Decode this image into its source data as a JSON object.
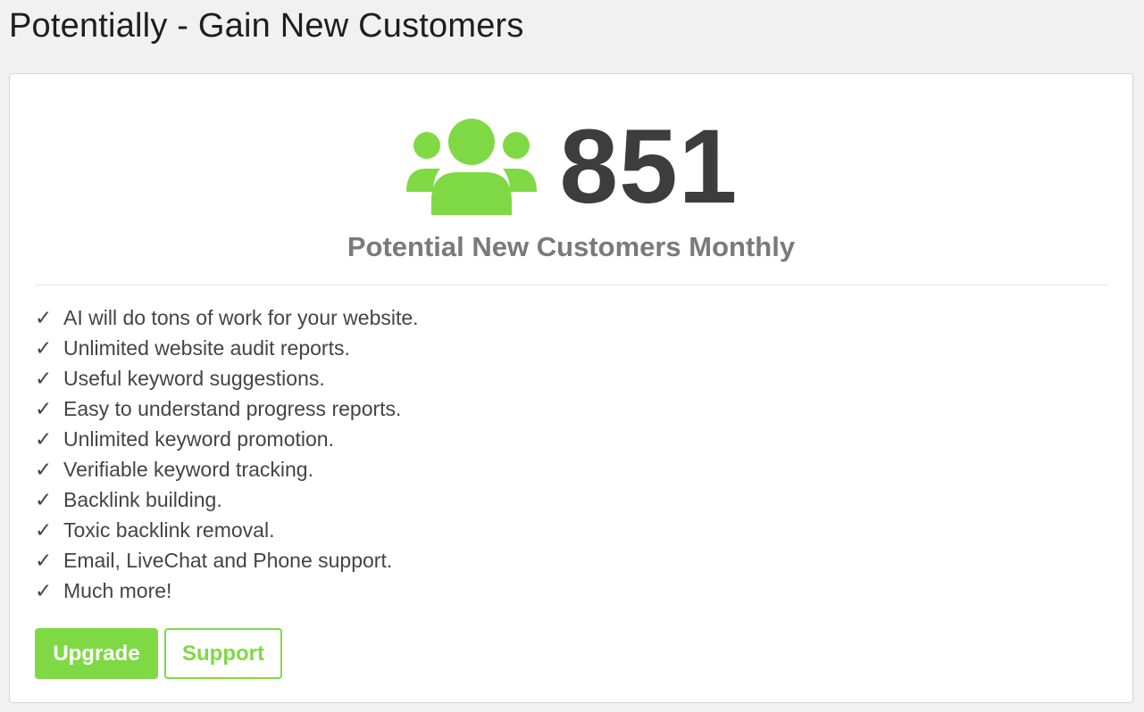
{
  "page": {
    "title": "Potentially - Gain New Customers"
  },
  "stat": {
    "icon": "users-icon",
    "value": "851",
    "label": "Potential New Customers Monthly"
  },
  "features": {
    "check_symbol": "✓",
    "items": [
      "AI will do tons of work for your website.",
      "Unlimited website audit reports.",
      "Useful keyword suggestions.",
      "Easy to understand progress reports.",
      "Unlimited keyword promotion.",
      "Verifiable keyword tracking.",
      "Backlink building.",
      "Toxic backlink removal.",
      "Email, LiveChat and Phone support.",
      "Much more!"
    ]
  },
  "buttons": {
    "upgrade_label": "Upgrade",
    "support_label": "Support"
  },
  "colors": {
    "accent": "#7fd944",
    "number": "#3d3d3d",
    "subtitle": "#7a7a7a",
    "text": "#444444",
    "background": "#f1f1f1",
    "card": "#ffffff"
  }
}
